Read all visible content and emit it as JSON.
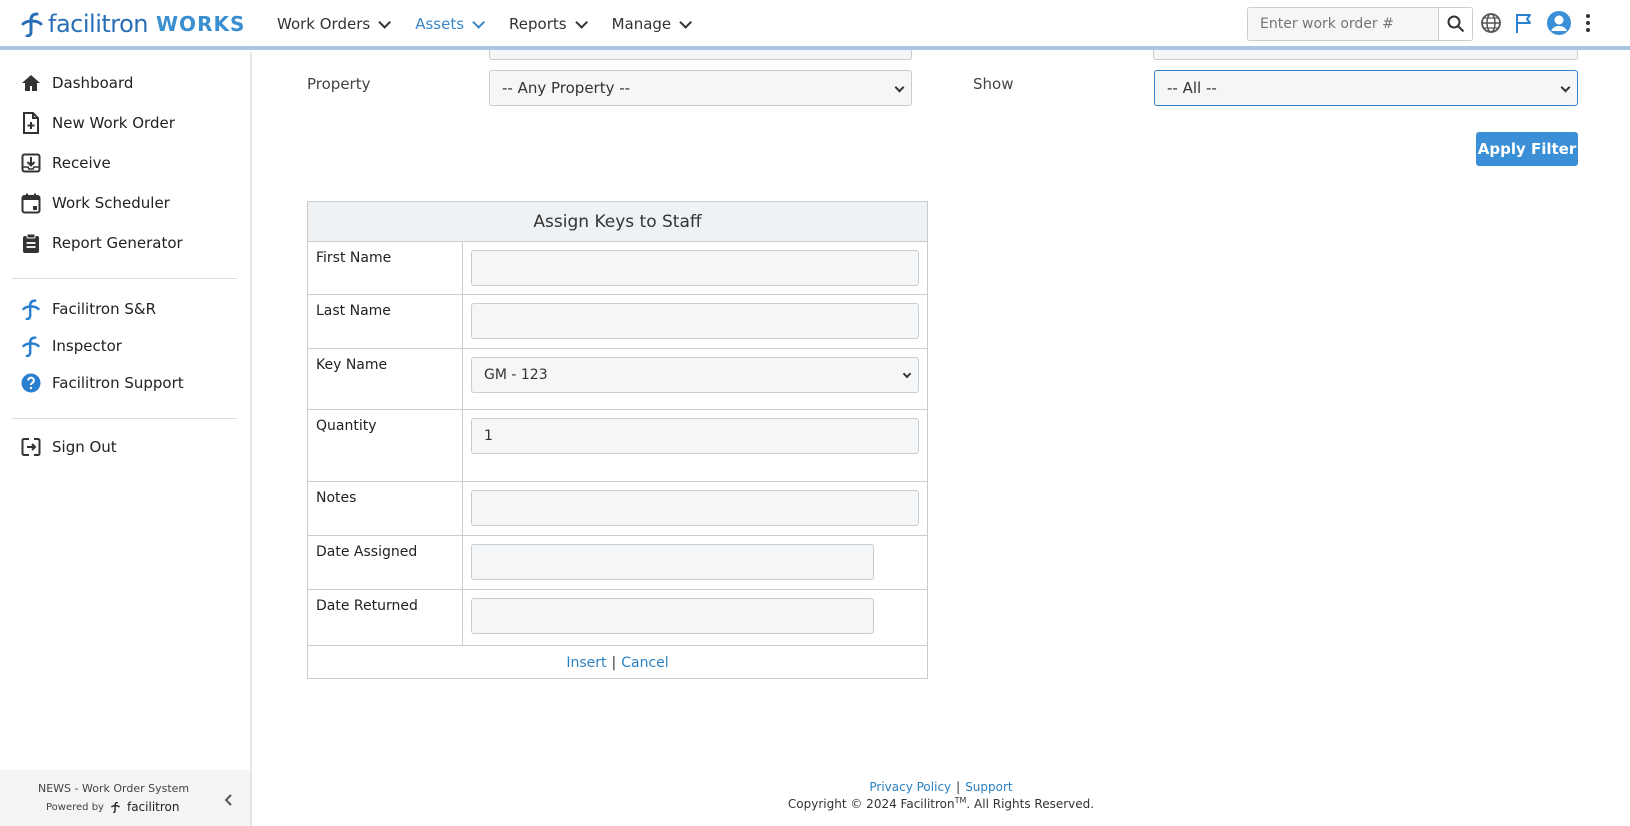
{
  "header": {
    "brand": "facilitron",
    "product": "WORKS",
    "nav": [
      {
        "label": "Work Orders"
      },
      {
        "label": "Assets"
      },
      {
        "label": "Reports"
      },
      {
        "label": "Manage"
      }
    ],
    "search_placeholder": "Enter work order #"
  },
  "sidebar": {
    "items": [
      {
        "label": "Dashboard",
        "icon": "home-icon"
      },
      {
        "label": "New Work Order",
        "icon": "file-plus-icon"
      },
      {
        "label": "Receive",
        "icon": "inbox-icon"
      },
      {
        "label": "Work Scheduler",
        "icon": "calendar-icon"
      },
      {
        "label": "Report Generator",
        "icon": "clipboard-icon"
      }
    ],
    "apps": [
      {
        "label": "Facilitron S&R",
        "icon": "facilitron-logo-icon"
      },
      {
        "label": "Inspector",
        "icon": "facilitron-logo-icon"
      },
      {
        "label": "Facilitron Support",
        "icon": "help-icon"
      }
    ],
    "signout": "Sign Out",
    "footer": {
      "system": "NEWS - Work Order System",
      "powered": "Powered by",
      "powered_brand": "facilitron"
    }
  },
  "filters": {
    "property_label": "Property",
    "property_value": "-- Any Property --",
    "show_label": "Show",
    "show_value": "-- All --",
    "apply": "Apply Filter"
  },
  "form": {
    "title": "Assign Keys to Staff",
    "first_name_label": "First Name",
    "first_name_value": "",
    "last_name_label": "Last Name",
    "last_name_value": "",
    "key_name_label": "Key Name",
    "key_name_value": "GM - 123",
    "quantity_label": "Quantity",
    "quantity_value": "1",
    "notes_label": "Notes",
    "notes_value": "",
    "date_assigned_label": "Date Assigned",
    "date_assigned_value": "",
    "date_returned_label": "Date Returned",
    "date_returned_value": "",
    "insert": "Insert",
    "cancel": "Cancel",
    "separator": "|"
  },
  "footer": {
    "privacy": "Privacy Policy",
    "support": "Support",
    "separator": "|",
    "copyright": "Copyright © 2024 Facilitron",
    "tm": "TM",
    "rights": ". All Rights Reserved."
  },
  "colors": {
    "accent": "#3a8fd6",
    "link": "#2a80c0",
    "nav_active": "#3a87c8"
  }
}
